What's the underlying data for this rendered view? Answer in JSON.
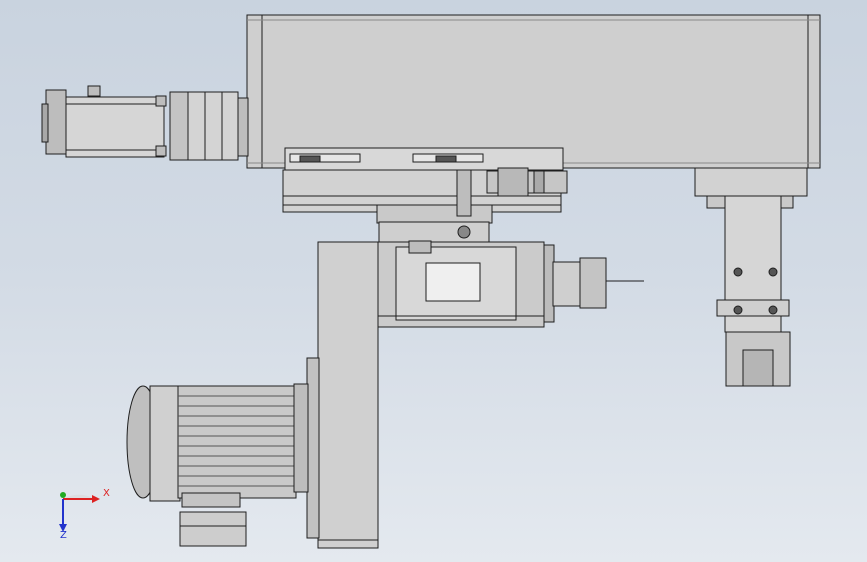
{
  "viewport": {
    "background_top": "#c9d3df",
    "background_bottom": "#e4e9ef"
  },
  "colors": {
    "part_fill": "#cdcdcd",
    "part_light": "#e2e2e2",
    "part_dark": "#9c9c9c",
    "outline": "#1e1e1e"
  },
  "triad": {
    "x_label": "X",
    "z_label": "Z",
    "x_color": "#dd2222",
    "y_color": "#22aa22",
    "z_color": "#2233cc"
  },
  "components": [
    {
      "id": "main-beam",
      "label": "main-housing"
    },
    {
      "id": "servo-motor",
      "label": "servo-motor"
    },
    {
      "id": "linear-slide",
      "label": "linear-slide"
    },
    {
      "id": "spindle-head",
      "label": "spindle-head"
    },
    {
      "id": "tool-holder",
      "label": "collet-chuck"
    },
    {
      "id": "drive-motor",
      "label": "drive-motor"
    },
    {
      "id": "belt-guard",
      "label": "belt-guard"
    },
    {
      "id": "clamp-bracket",
      "label": "clamp-bracket"
    }
  ]
}
